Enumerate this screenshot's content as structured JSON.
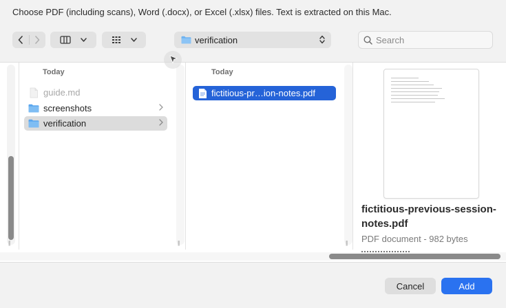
{
  "instructions": "Choose PDF (including scans), Word (.docx), or Excel (.xlsx) files. Text is extracted on this Mac.",
  "toolbar": {
    "back_icon": "chevron-left-icon",
    "forward_icon": "chevron-right-icon",
    "view_icon": "column-view-icon",
    "group_icon": "grid-icon",
    "path_folder": "verification",
    "search_placeholder": "Search"
  },
  "columns": {
    "middle": {
      "header": "Today",
      "items": [
        {
          "name": "guide.md",
          "kind": "file",
          "state": "disabled"
        },
        {
          "name": "screenshots",
          "kind": "folder",
          "state": "normal"
        },
        {
          "name": "verification",
          "kind": "folder",
          "state": "selected"
        }
      ]
    },
    "right": {
      "header": "Today",
      "items": [
        {
          "name": "fictitious-pr…ion-notes.pdf",
          "kind": "pdf",
          "state": "selected"
        }
      ]
    }
  },
  "preview": {
    "title": "fictitious-previous-session-notes.pdf",
    "meta": "PDF document - 982 bytes"
  },
  "footer": {
    "cancel_label": "Cancel",
    "add_label": "Add"
  },
  "colors": {
    "accent": "#2563d8",
    "add_button": "#2a72f0",
    "folder": "#6cb2f0"
  }
}
